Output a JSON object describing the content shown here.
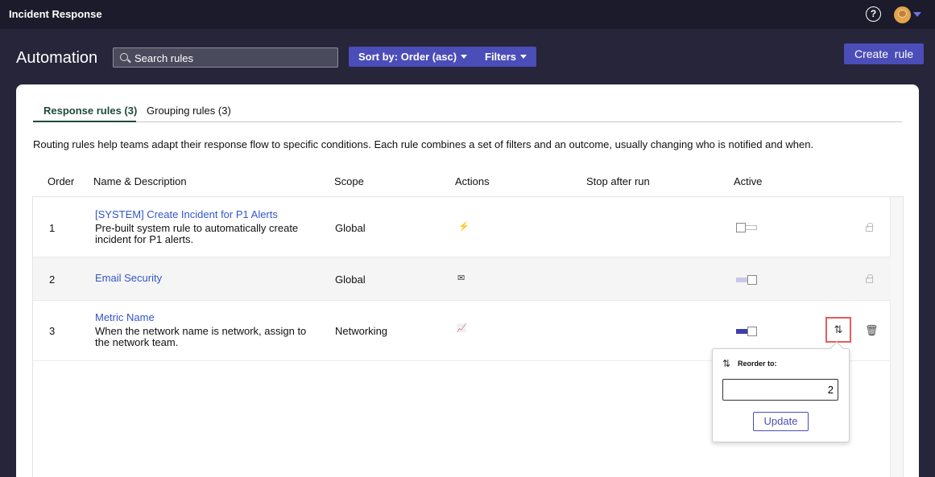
{
  "topbar": {
    "app_title": "Incident Response",
    "help_icon": "?"
  },
  "header": {
    "page_title": "Automation",
    "search_placeholder": "Search rules",
    "sort_label": "Sort by: Order (asc)",
    "filters_label": "Filters",
    "create_label": "Create  rule"
  },
  "tabs": [
    {
      "label": "Response rules (3)",
      "active": true
    },
    {
      "label": "Grouping rules (3)",
      "active": false
    }
  ],
  "description": "Routing rules help teams adapt their response flow to specific conditions. Each rule combines a set of filters and an outcome, usually changing who is notified and when.",
  "columns": [
    "Order",
    "Name & Description",
    "Scope",
    "Actions",
    "Stop after run",
    "Active"
  ],
  "rules": [
    {
      "order": "1",
      "name": "[SYSTEM] Create Incident for P1 Alerts",
      "description": "Pre-built system rule to automatically create incident for P1 alerts.",
      "scope": "Global",
      "action_icon": "bolt-icon",
      "active": "off",
      "locked": true
    },
    {
      "order": "2",
      "name": "Email Security",
      "description": "",
      "scope": "Global",
      "action_icon": "mail-icon",
      "active": "on",
      "locked": true
    },
    {
      "order": "3",
      "name": "Metric Name",
      "description": "When the network name is network, assign to the network team.",
      "scope": "Networking",
      "action_icon": "chart-icon",
      "active": "on",
      "locked": false
    }
  ],
  "icons": {
    "bolt": "⚡",
    "mail": "✉",
    "chart": "📈",
    "reorder": "⇅",
    "trash": "🗑"
  },
  "popover": {
    "title": "Reorder to:",
    "value": "2",
    "update_label": "Update"
  },
  "colors": {
    "accent": "#4b4db8",
    "link": "#3555c8",
    "topbar": "#1c1b2b",
    "background": "#26253a",
    "highlight": "#e35d5d"
  }
}
